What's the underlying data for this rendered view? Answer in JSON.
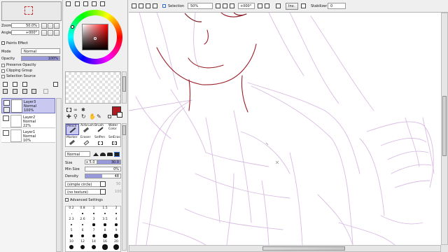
{
  "navigator": {
    "zoom_label": "Zoom",
    "zoom_value": "50.0%",
    "angle_label": "Angle",
    "angle_value": "+000°"
  },
  "layer_panel": {
    "paints_effect": "Paints Effect",
    "mode_label": "Mode",
    "mode_value": "Normal",
    "opacity_label": "Opacity",
    "opacity_value": "100%",
    "preserve_opacity": "Preserve Opacity",
    "clipping_group": "Clipping Group",
    "selection_source": "Selection Source",
    "layers": [
      {
        "name": "Layer3",
        "mode": "Normal",
        "opacity": "100%"
      },
      {
        "name": "Layer2",
        "mode": "Normal",
        "opacity": "22%"
      },
      {
        "name": "Layer1",
        "mode": "Normal",
        "opacity": "10%"
      }
    ]
  },
  "colors": {
    "main": "#b01a22",
    "accent_layer_bg": "#c8c8f0",
    "line": "#9a1f2a",
    "sketch": "#c9a3d4"
  },
  "tools": {
    "row1": [
      "Pencil",
      "Airbrush",
      "Brush",
      "Water Color"
    ],
    "row2": [
      "Marker",
      "Eraser",
      "SelPen",
      "SelEras"
    ],
    "blend_mode": "Normal",
    "size_label": "Size",
    "size_mult": "x 5.0",
    "size_value": "30.0",
    "min_size_label": "Min Size",
    "min_size_value": "0%",
    "density_label": "Density",
    "density_value": "48",
    "shape_value": "(simple circle)",
    "shape_num": "50",
    "texture_value": "(no texture)",
    "texture_num": "100",
    "advanced_settings": "Advanced Settings",
    "brush_sizes": [
      [
        "0.2",
        "0.8",
        "1",
        "1.5",
        "2"
      ],
      [
        "2.3",
        "2.6",
        "3",
        "3.5",
        "4"
      ],
      [
        "5",
        "6",
        "7",
        "8",
        "9"
      ],
      [
        "10",
        "12",
        "14",
        "16",
        "20"
      ]
    ]
  },
  "toolbar": {
    "selection_label": "Selection",
    "zoom_value": "50%",
    "angle_value": "+000°",
    "inv_label": "Inv.",
    "stabilizer_label": "Stabilizer",
    "stabilizer_value": "0"
  }
}
